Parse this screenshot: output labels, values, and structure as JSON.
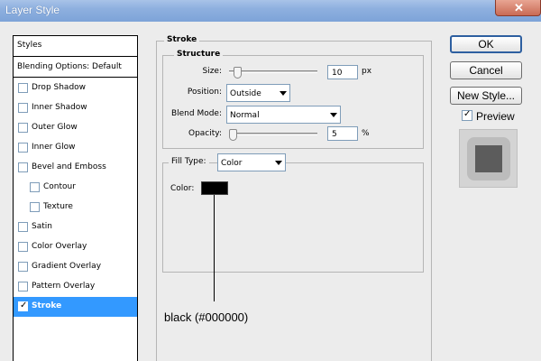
{
  "window": {
    "title": "Layer Style",
    "close_symbol": "✕"
  },
  "styles_panel": {
    "header": "Styles",
    "blending_options": "Blending Options: Default",
    "items": [
      {
        "label": "Drop Shadow",
        "checked": false
      },
      {
        "label": "Inner Shadow",
        "checked": false
      },
      {
        "label": "Outer Glow",
        "checked": false
      },
      {
        "label": "Inner Glow",
        "checked": false
      },
      {
        "label": "Bevel and Emboss",
        "checked": false
      },
      {
        "label": "Contour",
        "checked": false
      },
      {
        "label": "Texture",
        "checked": false
      },
      {
        "label": "Satin",
        "checked": false
      },
      {
        "label": "Color Overlay",
        "checked": false
      },
      {
        "label": "Gradient Overlay",
        "checked": false
      },
      {
        "label": "Pattern Overlay",
        "checked": false
      },
      {
        "label": "Stroke",
        "checked": true
      }
    ]
  },
  "stroke": {
    "section_title": "Stroke",
    "structure_title": "Structure",
    "size_label": "Size:",
    "size_value": "10",
    "size_unit": "px",
    "position_label": "Position:",
    "position_value": "Outside",
    "blend_mode_label": "Blend Mode:",
    "blend_mode_value": "Normal",
    "opacity_label": "Opacity:",
    "opacity_value": "5",
    "opacity_unit": "%",
    "fill_type_label": "Fill Type:",
    "fill_type_value": "Color",
    "color_label": "Color:",
    "color_value": "#000000"
  },
  "buttons": {
    "ok": "OK",
    "cancel": "Cancel",
    "new_style": "New Style..."
  },
  "preview": {
    "label": "Preview",
    "checked": true
  },
  "annotation": {
    "text": "black (#000000)"
  }
}
